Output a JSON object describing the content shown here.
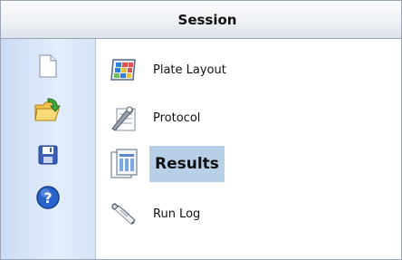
{
  "window": {
    "title": "Session"
  },
  "toolbar": {
    "buttons": [
      {
        "icon": "new-document-icon"
      },
      {
        "icon": "open-folder-icon"
      },
      {
        "icon": "save-disk-icon"
      },
      {
        "icon": "help-icon"
      }
    ]
  },
  "nav": {
    "items": [
      {
        "label": "Plate Layout",
        "icon": "plate-layout-icon",
        "selected": false
      },
      {
        "label": "Protocol",
        "icon": "protocol-wrench-icon",
        "selected": false
      },
      {
        "label": "Results",
        "icon": "results-icon",
        "selected": true
      },
      {
        "label": "Run Log",
        "icon": "run-log-scroll-icon",
        "selected": false
      }
    ]
  },
  "colors": {
    "selected_bg": "#b8cfe8",
    "toolbar_bg": "#d5e4f7",
    "help_blue": "#2a63c9"
  }
}
